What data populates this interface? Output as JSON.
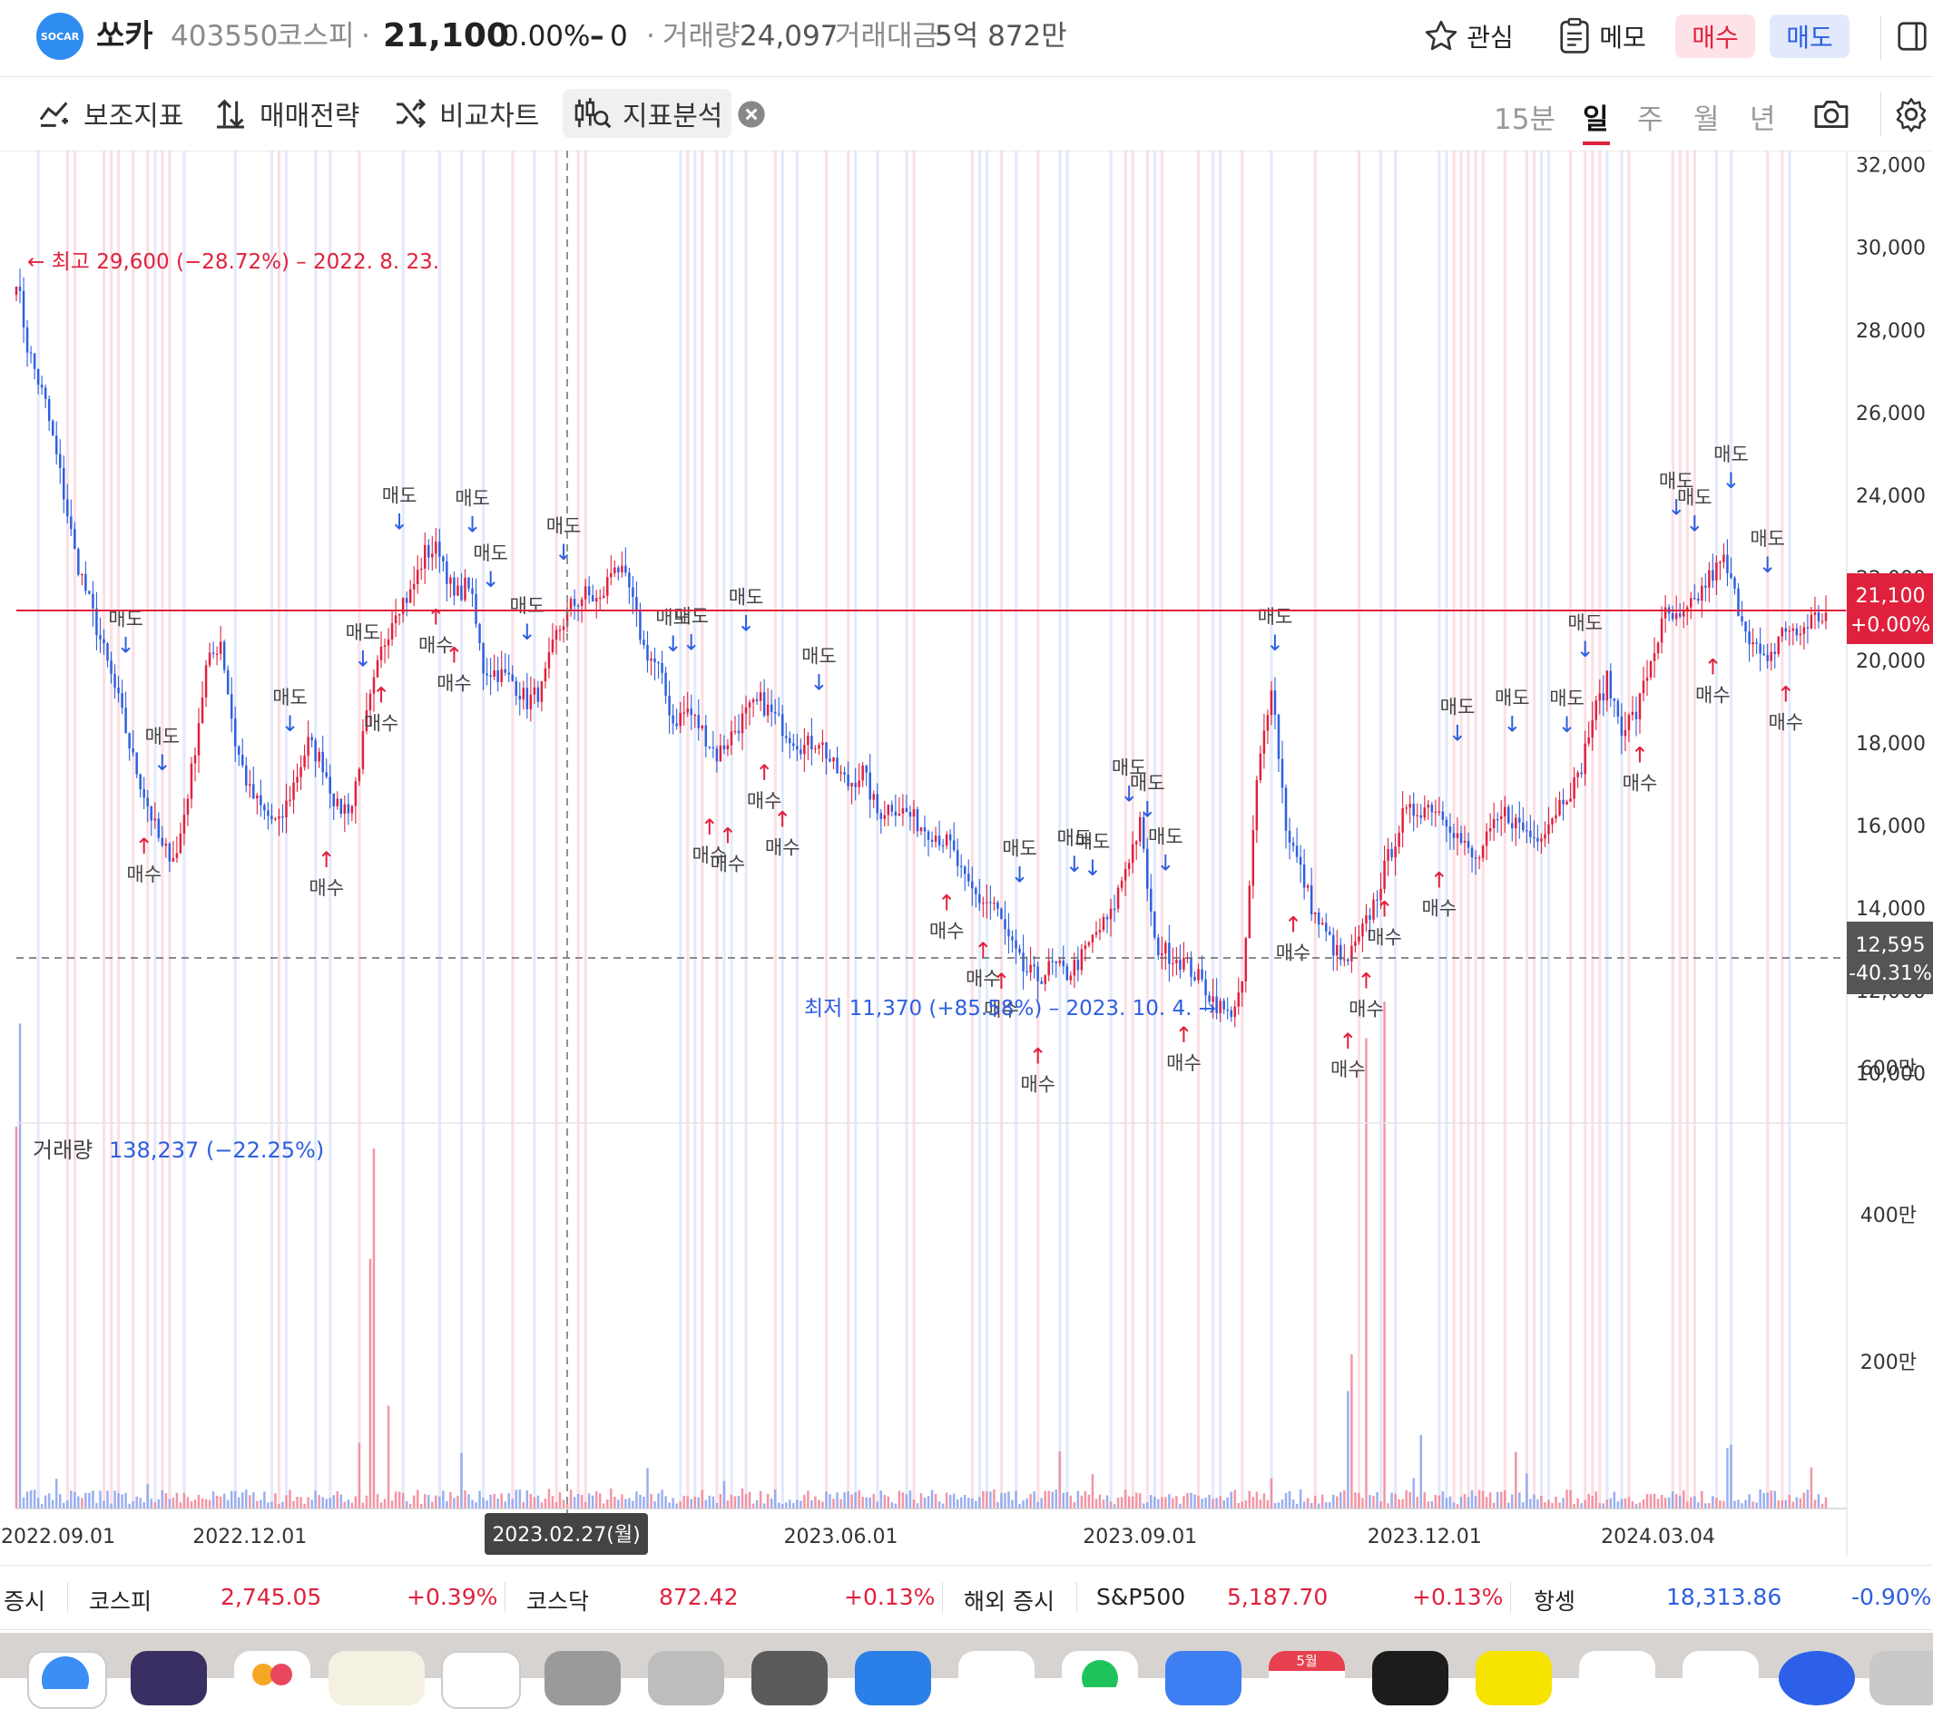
{
  "header": {
    "logo_text": "SOCAR",
    "stock_name": "쏘카",
    "stock_code": "403550",
    "market": "코스피",
    "separator": "·",
    "price": "21,100",
    "change_pct": "0.00%",
    "change_abs": "0",
    "volume_label": "거래량",
    "volume_value": "24,097",
    "amount_label": "거래대금",
    "amount_value": "5억 872만",
    "watch_label": "관심",
    "memo_label": "메모",
    "buy_label": "매수",
    "sell_label": "매도",
    "colors": {
      "up": "#e0213d",
      "down": "#2e5fe0"
    }
  },
  "toolbar": {
    "indicator_label": "보조지표",
    "strategy_label": "매매전략",
    "compare_label": "비교차트",
    "analysis_label": "지표분석",
    "periods": [
      "15분",
      "일",
      "주",
      "월",
      "년"
    ],
    "active_period": "일"
  },
  "chart_data": {
    "type": "candlestick",
    "y_ticks": [
      "32,000",
      "30,000",
      "28,000",
      "26,000",
      "24,000",
      "22,000",
      "20,000",
      "18,000",
      "16,000",
      "14,000",
      "12,000",
      "10,000"
    ],
    "ylim": [
      9500,
      32300
    ],
    "x_ticks": [
      "2022.09.01",
      "2022.12.01",
      "2023.06.01",
      "2023.09.01",
      "2023.12.01",
      "2024.03.04"
    ],
    "crosshair_date": "2023.02.27(월)",
    "current_price_label": "21,100",
    "current_change_label": "+0.00%",
    "crosshair_price_label": "12,595",
    "crosshair_change_label": "-40.31%",
    "high_annotation": "← 최고 29,600 (−28.72%) – 2022. 8. 23.",
    "low_annotation": "최저 11,370 (+85.58%) – 2023. 10. 4. →",
    "volume_title": "거래량",
    "volume_value": "138,237 (−22.25%)",
    "volume_ticks": [
      "600만",
      "400만",
      "200만"
    ],
    "signal_buy": "매수",
    "signal_sell": "매도",
    "anchors": [
      [
        0,
        29300
      ],
      [
        3,
        27600
      ],
      [
        8,
        26200
      ],
      [
        12,
        24500
      ],
      [
        16,
        22600
      ],
      [
        20,
        21400
      ],
      [
        24,
        20200
      ],
      [
        28,
        19000
      ],
      [
        32,
        17600
      ],
      [
        36,
        16500
      ],
      [
        40,
        15400
      ],
      [
        44,
        15300
      ],
      [
        48,
        17300
      ],
      [
        52,
        19800
      ],
      [
        56,
        20500
      ],
      [
        60,
        18000
      ],
      [
        64,
        16800
      ],
      [
        68,
        16300
      ],
      [
        72,
        16000
      ],
      [
        76,
        17000
      ],
      [
        80,
        18000
      ],
      [
        84,
        17500
      ],
      [
        88,
        16400
      ],
      [
        92,
        16500
      ],
      [
        96,
        18600
      ],
      [
        100,
        20200
      ],
      [
        104,
        21300
      ],
      [
        108,
        21600
      ],
      [
        112,
        22600
      ],
      [
        116,
        22700
      ],
      [
        120,
        21500
      ],
      [
        124,
        21900
      ],
      [
        128,
        19800
      ],
      [
        132,
        19700
      ],
      [
        136,
        19500
      ],
      [
        140,
        19000
      ],
      [
        144,
        19300
      ],
      [
        148,
        20600
      ],
      [
        152,
        21300
      ],
      [
        156,
        21600
      ],
      [
        160,
        21400
      ],
      [
        164,
        22400
      ],
      [
        168,
        21700
      ],
      [
        172,
        20300
      ],
      [
        176,
        19800
      ],
      [
        180,
        18500
      ],
      [
        184,
        18800
      ],
      [
        188,
        18300
      ],
      [
        192,
        17700
      ],
      [
        196,
        18200
      ],
      [
        200,
        18700
      ],
      [
        204,
        19000
      ],
      [
        208,
        18600
      ],
      [
        212,
        18200
      ],
      [
        216,
        17900
      ],
      [
        220,
        18100
      ],
      [
        224,
        17400
      ],
      [
        228,
        17000
      ],
      [
        232,
        17300
      ],
      [
        236,
        16300
      ],
      [
        240,
        16500
      ],
      [
        244,
        16300
      ],
      [
        248,
        16000
      ],
      [
        252,
        15800
      ],
      [
        256,
        15500
      ],
      [
        260,
        14600
      ],
      [
        264,
        14200
      ],
      [
        268,
        14100
      ],
      [
        272,
        13200
      ],
      [
        276,
        12500
      ],
      [
        280,
        12300
      ],
      [
        284,
        12600
      ],
      [
        288,
        12400
      ],
      [
        292,
        12800
      ],
      [
        296,
        13400
      ],
      [
        300,
        13800
      ],
      [
        304,
        15000
      ],
      [
        308,
        16000
      ],
      [
        312,
        13100
      ],
      [
        316,
        12900
      ],
      [
        320,
        12700
      ],
      [
        324,
        12300
      ],
      [
        328,
        11800
      ],
      [
        332,
        11400
      ],
      [
        336,
        12000
      ],
      [
        340,
        17000
      ],
      [
        344,
        19500
      ],
      [
        348,
        16000
      ],
      [
        352,
        14900
      ],
      [
        356,
        13800
      ],
      [
        360,
        13200
      ],
      [
        364,
        12600
      ],
      [
        368,
        13200
      ],
      [
        372,
        14100
      ],
      [
        376,
        15200
      ],
      [
        380,
        16200
      ],
      [
        384,
        16400
      ],
      [
        388,
        16500
      ],
      [
        392,
        16200
      ],
      [
        396,
        15600
      ],
      [
        400,
        15100
      ],
      [
        404,
        15800
      ],
      [
        408,
        16300
      ],
      [
        412,
        16000
      ],
      [
        416,
        15700
      ],
      [
        420,
        16100
      ],
      [
        424,
        16700
      ],
      [
        428,
        17100
      ],
      [
        432,
        18600
      ],
      [
        436,
        19500
      ],
      [
        440,
        18400
      ],
      [
        444,
        18700
      ],
      [
        448,
        20000
      ],
      [
        452,
        21100
      ],
      [
        456,
        20900
      ],
      [
        460,
        21400
      ],
      [
        464,
        22000
      ],
      [
        468,
        22400
      ],
      [
        472,
        21300
      ],
      [
        476,
        20400
      ],
      [
        480,
        19800
      ],
      [
        484,
        20800
      ],
      [
        488,
        20600
      ],
      [
        492,
        21000
      ],
      [
        496,
        21100
      ]
    ]
  },
  "ticker": {
    "domestic_label": "증시",
    "kospi_label": "코스피",
    "kospi_value": "2,745.05",
    "kospi_change": "+0.39%",
    "kosdaq_label": "코스닥",
    "kosdaq_value": "872.42",
    "kosdaq_change": "+0.13%",
    "foreign_label": "해외 증시",
    "sp_label": "S&P500",
    "sp_value": "5,187.70",
    "sp_change": "+0.13%",
    "hs_label": "항셍",
    "hs_value": "18,313.86",
    "hs_change": "-0.90%"
  },
  "dock": {
    "calendar_month": "5월"
  }
}
